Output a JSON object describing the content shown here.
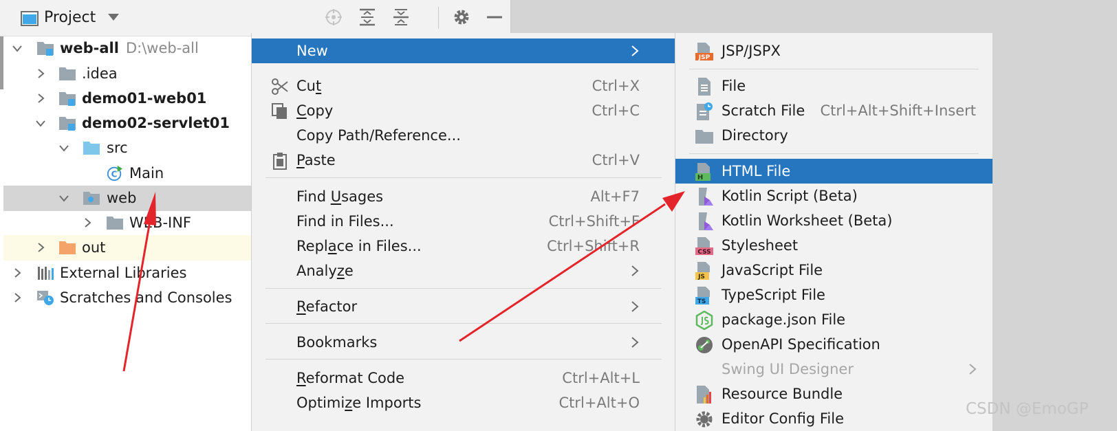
{
  "header": {
    "title": "Project"
  },
  "tree": [
    {
      "label": "web-all",
      "path": "D:\\web-all"
    },
    {
      "label": ".idea"
    },
    {
      "label": "demo01-web01"
    },
    {
      "label": "demo02-servlet01"
    },
    {
      "label": "src"
    },
    {
      "label": "Main"
    },
    {
      "label": "web"
    },
    {
      "label": "WEB-INF"
    },
    {
      "label": "out"
    },
    {
      "label": "External Libraries"
    },
    {
      "label": "Scratches and Consoles"
    }
  ],
  "context_menu": [
    {
      "label": "New"
    },
    {
      "pre": "Cu",
      "ul": "t",
      "post": "",
      "shortcut": "Ctrl+X"
    },
    {
      "pre": "",
      "ul": "C",
      "post": "opy",
      "shortcut": "Ctrl+C"
    },
    {
      "label": "Copy Path/Reference..."
    },
    {
      "pre": "",
      "ul": "P",
      "post": "aste",
      "shortcut": "Ctrl+V"
    },
    {
      "pre": "Find ",
      "ul": "U",
      "post": "sages",
      "shortcut": "Alt+F7"
    },
    {
      "label": "Find in Files...",
      "shortcut": "Ctrl+Shift+F"
    },
    {
      "pre": "Repl",
      "ul": "a",
      "post": "ce in Files...",
      "shortcut": "Ctrl+Shift+R"
    },
    {
      "pre": "Analy",
      "ul": "z",
      "post": "e"
    },
    {
      "pre": "",
      "ul": "R",
      "post": "efactor"
    },
    {
      "label": "Bookmarks"
    },
    {
      "pre": "",
      "ul": "R",
      "post": "eformat Code",
      "shortcut": "Ctrl+Alt+L"
    },
    {
      "pre": "Optimi",
      "ul": "z",
      "post": "e Imports",
      "shortcut": "Ctrl+Alt+O"
    }
  ],
  "submenu": [
    {
      "label": "JSP/JSPX",
      "icon_text": "JSP"
    },
    {
      "label": "File"
    },
    {
      "label": "Scratch File",
      "shortcut": "Ctrl+Alt+Shift+Insert"
    },
    {
      "label": "Directory"
    },
    {
      "label": "HTML File",
      "icon_text": "H"
    },
    {
      "label": "Kotlin Script (Beta)"
    },
    {
      "label": "Kotlin Worksheet (Beta)"
    },
    {
      "label": "Stylesheet",
      "icon_text": "CSS"
    },
    {
      "label": "JavaScript File",
      "icon_text": "JS"
    },
    {
      "label": "TypeScript File",
      "icon_text": "TS"
    },
    {
      "label": "package.json File"
    },
    {
      "label": "OpenAPI Specification"
    },
    {
      "label": "Swing UI Designer"
    },
    {
      "label": "Resource Bundle"
    },
    {
      "label": "Editor Config File"
    }
  ],
  "watermark": "CSDN @EmoGP",
  "colors": {
    "selection": "#2675bf",
    "annotation_arrow": "#e3242b",
    "tree_selected": "#d5d5d5"
  }
}
